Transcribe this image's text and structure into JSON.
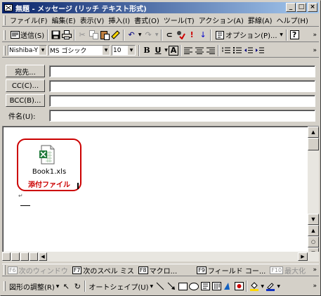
{
  "window": {
    "title": "無題 - メッセージ (リッチ テキスト形式)",
    "controls": [
      "_",
      "□",
      "×"
    ]
  },
  "menubar": {
    "items": [
      "ファイル(F)",
      "編集(E)",
      "表示(V)",
      "挿入(I)",
      "書式(O)",
      "ツール(T)",
      "アクション(A)",
      "罫線(A)",
      "ヘルプ(H)"
    ]
  },
  "toolbar": {
    "send_label": "送信(S)",
    "options_label": "オプション(P)...",
    "help_glyph": "?"
  },
  "format_bar": {
    "font_latin": "Nishiba-Y",
    "font_name": "MS ゴシック",
    "font_size": "10",
    "bold": "B",
    "underline": "U",
    "font_color": "A"
  },
  "header_fields": {
    "to_label": "宛先...",
    "cc_label": "CC(C)...",
    "bcc_label": "BCC(B)...",
    "subject_label": "件名(U):"
  },
  "body": {
    "attachment_name": "Book1.xls",
    "attachment_label": "添付ファイル",
    "enter_mark": "↵"
  },
  "fkey_bar": {
    "keys": [
      {
        "key": "F6",
        "label": "次のウィンドウ",
        "enabled": false
      },
      {
        "key": "F7",
        "label": "次のスペル ミス",
        "enabled": true
      },
      {
        "key": "F8",
        "label": "マクロ...",
        "enabled": true
      },
      {
        "key": "F9",
        "label": "フィールド コー...",
        "enabled": true
      },
      {
        "key": "F10",
        "label": "最大化",
        "enabled": false
      }
    ]
  },
  "drawing_bar": {
    "draw_label": "図形の調整(R)",
    "autoshape_label": "オートシェイプ(U)"
  },
  "colors": {
    "title_start": "#0a246a",
    "title_end": "#a6caf0",
    "annotation_red": "#cc0000",
    "face": "#d4d0c8"
  }
}
